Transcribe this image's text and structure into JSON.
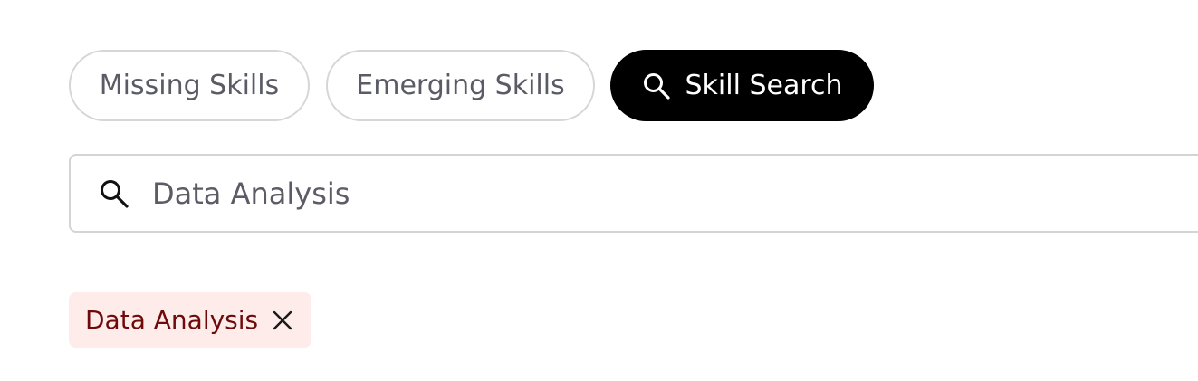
{
  "tabs": {
    "missing_label": "Missing Skills",
    "emerging_label": "Emerging Skills",
    "search_label": "Skill Search",
    "active": "Skill Search"
  },
  "search": {
    "value": "Data Analysis",
    "placeholder": ""
  },
  "selected_tags": [
    {
      "label": "Data Analysis"
    }
  ],
  "colors": {
    "active_pill_bg": "#000000",
    "active_pill_text": "#ffffff",
    "outline_pill_border": "#d6d6d6",
    "outline_pill_text": "#5b5b66",
    "chip_bg": "#fdecea",
    "chip_text": "#6e0a0a"
  },
  "icons": {
    "search_tab_icon": "search-icon",
    "search_field_icon": "search-icon",
    "chip_remove_icon": "close-icon"
  }
}
